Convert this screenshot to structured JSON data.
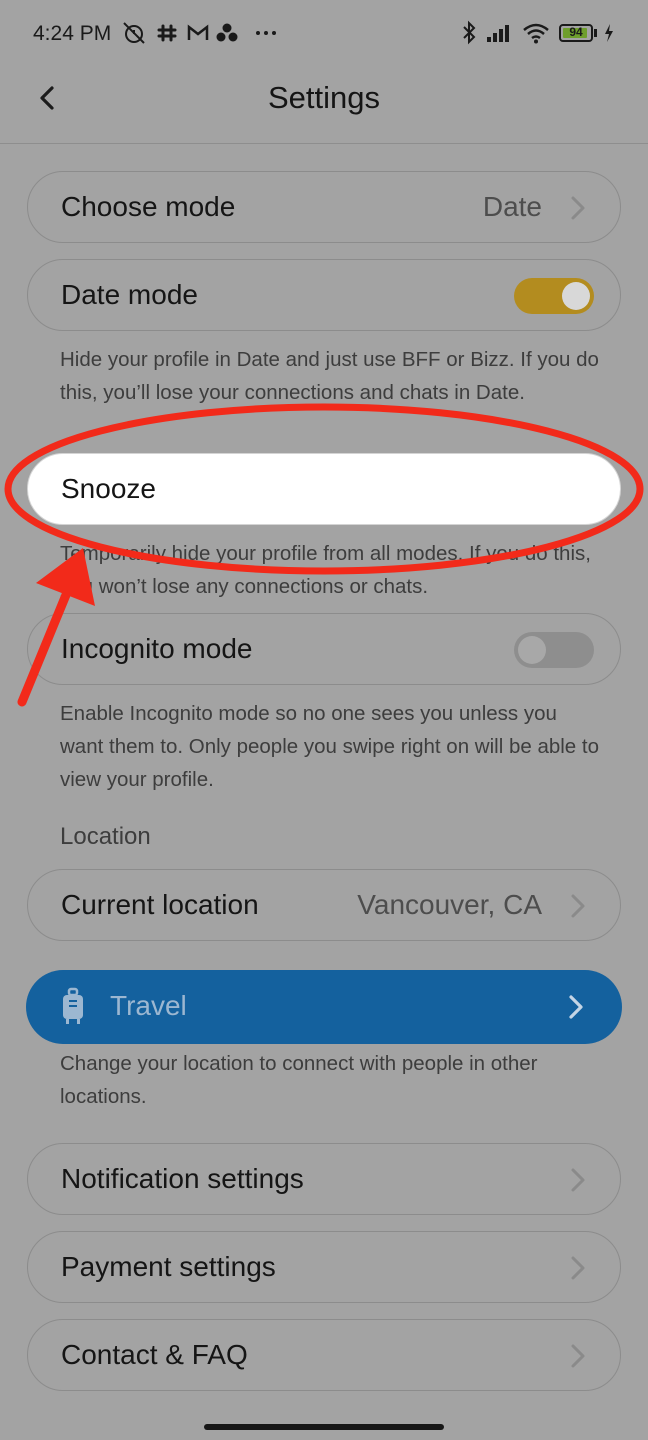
{
  "status_bar": {
    "time": "4:24 PM",
    "notification_icons": [
      "alarm-off-icon",
      "slack-icon",
      "gmail-icon",
      "cluster-icon",
      "more-dots-icon"
    ],
    "right_icons": [
      "bluetooth-icon",
      "signal-icon",
      "wifi-icon"
    ],
    "battery": {
      "level": 94,
      "label": "94",
      "charging": true
    }
  },
  "header": {
    "title": "Settings",
    "back_icon": "chevron-left-icon"
  },
  "rows": {
    "choose_mode": {
      "label": "Choose mode",
      "value": "Date"
    },
    "date_mode": {
      "label": "Date mode",
      "toggle_on": true
    },
    "snooze": {
      "label": "Snooze"
    },
    "incognito": {
      "label": "Incognito mode",
      "toggle_on": false
    },
    "current_location": {
      "label": "Current location",
      "value": "Vancouver, CA"
    },
    "notification_settings": {
      "label": "Notification settings"
    },
    "payment_settings": {
      "label": "Payment settings"
    },
    "contact_faq": {
      "label": "Contact & FAQ"
    }
  },
  "descriptions": {
    "date_mode": "Hide your profile in Date and just use BFF or Bizz. If you do this, you’ll lose your connections and chats in Date.",
    "snooze": "Temporarily hide your profile from all modes. If you do this, you won’t lose any connections or chats.",
    "incognito": "Enable Incognito mode so no one sees you unless you want them to. Only people you swipe right on will be able to view your profile.",
    "travel": "Change your location to connect with people in other locations."
  },
  "location_section": {
    "label": "Location"
  },
  "travel": {
    "label": "Travel",
    "icon": "suitcase-icon"
  },
  "colors": {
    "dim_background": "#a3a3a3",
    "toggle_on": "#b38c1f",
    "travel_blue": "#14619e",
    "highlight_red": "#f22a1a"
  },
  "annotation": {
    "highlight": "snooze-row",
    "ellipse_color": "#f22a1a",
    "arrow_color": "#f22a1a"
  }
}
